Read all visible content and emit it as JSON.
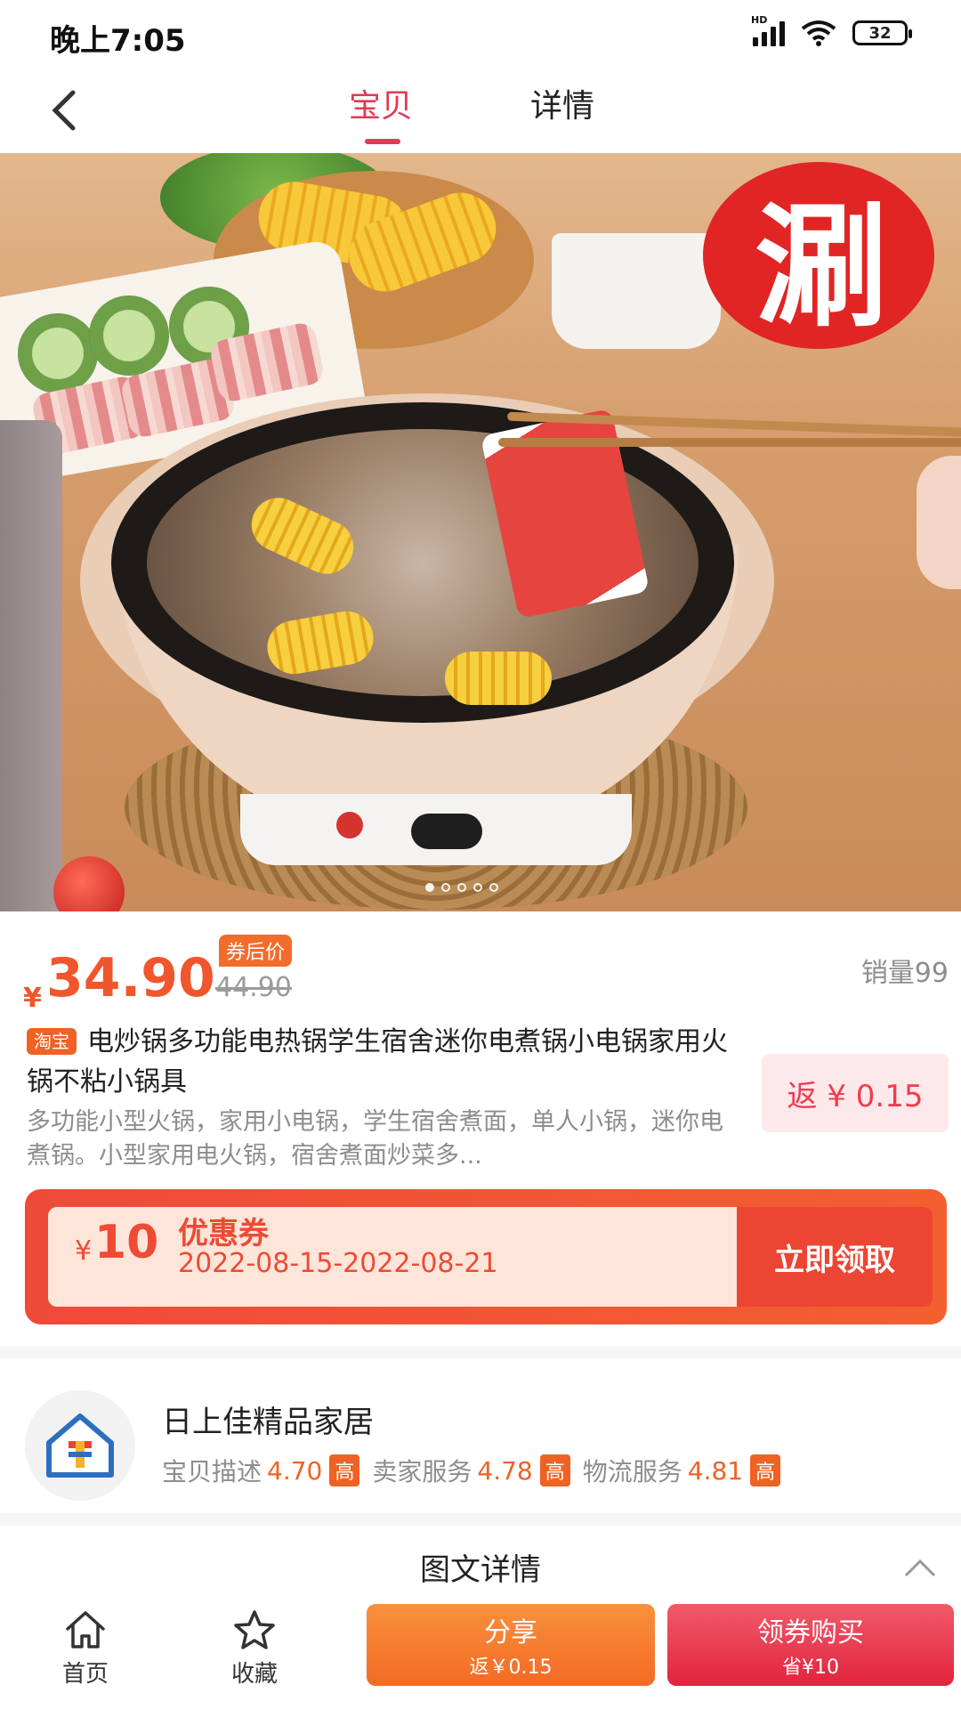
{
  "status_bar": {
    "time": "晚上7:05",
    "network": "HD",
    "battery": "32"
  },
  "nav": {
    "tabs": [
      {
        "label": "宝贝",
        "active": true
      },
      {
        "label": "详情",
        "active": false
      }
    ],
    "accent_color": "#e03a55"
  },
  "hero": {
    "badge_text": "涮",
    "carousel_total": 5,
    "carousel_active": 1
  },
  "product": {
    "currency": "¥",
    "price": "34.90",
    "after_coupon_label": "券后价",
    "original_price": "44.90",
    "sales": "销量99",
    "platform_tag": "淘宝",
    "title": "电炒锅多功能电热锅学生宿舍迷你电煮锅小电锅家用火锅不粘小锅具",
    "description": "多功能小型火锅，家用小电锅，学生宿舍煮面，单人小锅，迷你电煮锅。小型家用电火锅，宿舍煮面炒菜多...",
    "cashback": "返 ¥ 0.15",
    "price_color": "#f0562b"
  },
  "coupon": {
    "currency": "¥",
    "amount": "10",
    "label": "优惠券",
    "date_range": "2022-08-15-2022-08-21",
    "button": "立即领取"
  },
  "shop": {
    "name": "日上佳精品家居",
    "scores": [
      {
        "label": "宝贝描述",
        "value": "4.70",
        "tag": "高"
      },
      {
        "label": "卖家服务",
        "value": "4.78",
        "tag": "高"
      },
      {
        "label": "物流服务",
        "value": "4.81",
        "tag": "高"
      }
    ]
  },
  "detail": {
    "title": "图文详情"
  },
  "bottom_bar": {
    "home_label": "首页",
    "fav_label": "收藏",
    "share_main": "分享",
    "share_sub": "返￥0.15",
    "buy_main": "领券购买",
    "buy_sub": "省¥10"
  }
}
